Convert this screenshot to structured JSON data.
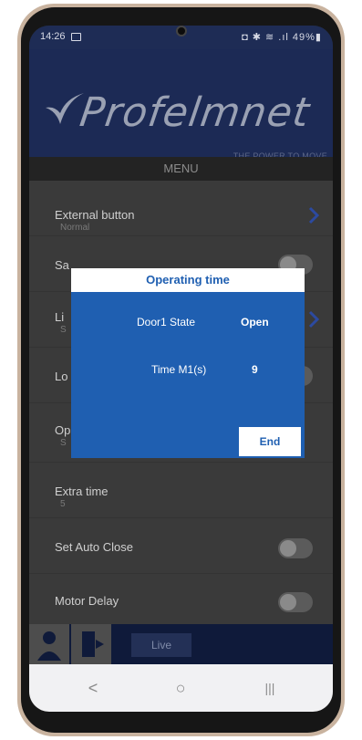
{
  "status_bar": {
    "time": "14:26",
    "right_text": "◘ ✱ ≋ .ıl 49%▮"
  },
  "header": {
    "brand": "Profelmnet",
    "tagline": "THE POWER TO MOVE"
  },
  "menu": {
    "title": "MENU"
  },
  "list_items": [
    {
      "title": "External button",
      "subtitle": "Normal"
    },
    {
      "title": "Sa"
    },
    {
      "title": "Li",
      "subtitle": "S"
    },
    {
      "title": "Lo"
    },
    {
      "title": "Op",
      "subtitle": "S"
    },
    {
      "title": "Extra time",
      "subtitle": "5"
    },
    {
      "title": "Set Auto Close"
    },
    {
      "title": "Motor Delay"
    }
  ],
  "dialog": {
    "title": "Operating time",
    "rows": [
      {
        "label": "Door1 State",
        "value": "Open"
      },
      {
        "label": "Time M1(s)",
        "value": "9"
      }
    ],
    "end_label": "End"
  },
  "bottom_bar": {
    "live_label": "Live"
  },
  "nav_bar": {
    "back": "<",
    "home": "○",
    "recents": "|||"
  },
  "colors": {
    "dialog_blue": "#1f5fb1",
    "header_navy": "#1c2a55",
    "accent_chevron": "#2c4aa0"
  }
}
